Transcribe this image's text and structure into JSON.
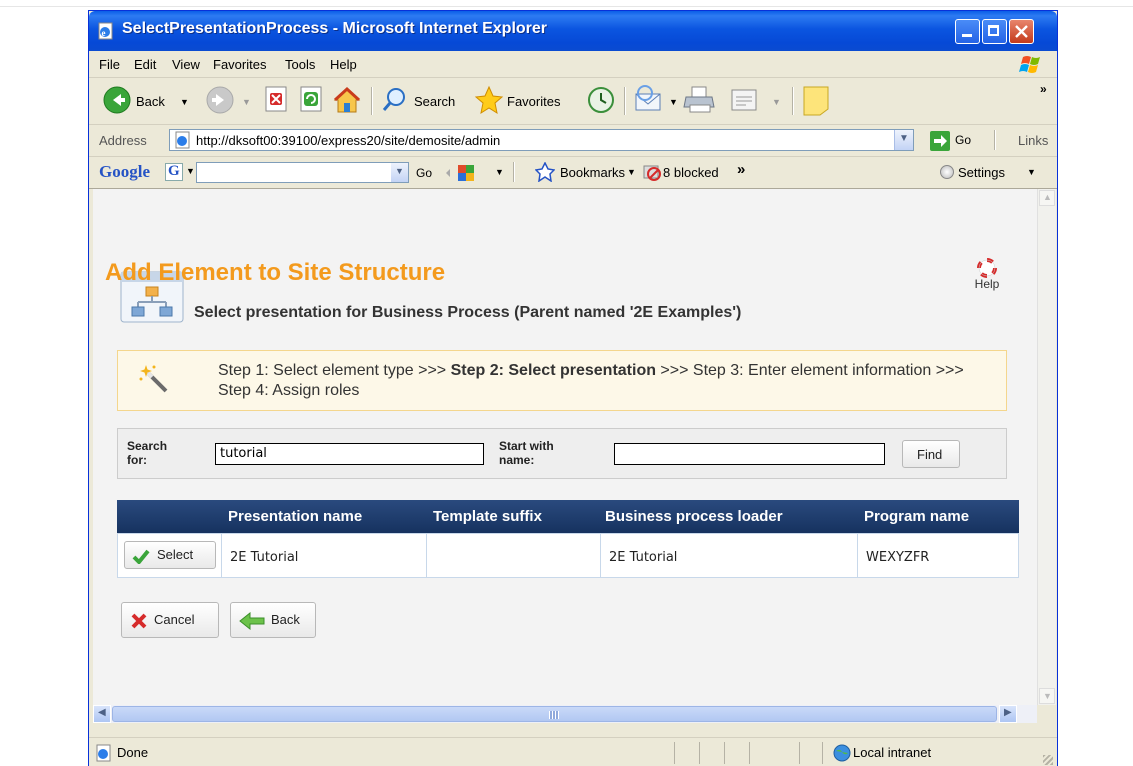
{
  "window": {
    "title": "SelectPresentationProcess - Microsoft Internet Explorer"
  },
  "menu": [
    "File",
    "Edit",
    "View",
    "Favorites",
    "Tools",
    "Help"
  ],
  "toolbar": {
    "back_label": "Back",
    "search_label": "Search",
    "favorites_label": "Favorites"
  },
  "address": {
    "label": "Address",
    "url": "http://dksoft00:39100/express20/site/demosite/admin",
    "go_label": "Go",
    "links_label": "Links"
  },
  "googlebar": {
    "logo_text": "Google",
    "g_text": "G",
    "go_label": "Go",
    "bookmarks_label": "Bookmarks",
    "blocked_label": "8 blocked",
    "overflow": "»",
    "settings_label": "Settings"
  },
  "page": {
    "title": "Add Element to Site Structure",
    "subtitle": "Select presentation for Business Process (Parent named '2E Examples')",
    "help_label": "Help",
    "steps": {
      "step1": "Step 1: Select element type >>> ",
      "step2": "Step 2: Select presentation",
      "rest": " >>> Step 3: Enter element information >>> Step 4: Assign roles"
    },
    "search": {
      "search_for_label": "Search for:",
      "search_for_value": "tutorial",
      "start_with_label": "Start with name:",
      "start_with_value": "",
      "find_label": "Find"
    },
    "table": {
      "headers": [
        "Presentation name",
        "Template suffix",
        "Business process loader",
        "Program name"
      ],
      "rows": [
        {
          "select_label": "Select",
          "presentation_name": "2E Tutorial",
          "template_suffix": "",
          "business_process_loader": "2E Tutorial",
          "program_name": "WEXYZFR"
        }
      ]
    },
    "cancel_label": "Cancel",
    "back_label": "Back"
  },
  "status": {
    "text": "Done",
    "zone": "Local intranet"
  },
  "colors": {
    "title_orange": "#f39a1d",
    "grid_header": "#1e3b6c",
    "xp_blue": "#0b55e0"
  }
}
